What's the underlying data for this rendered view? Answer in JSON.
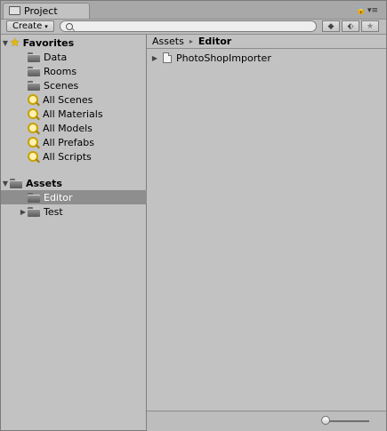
{
  "window": {
    "tab_title": "Project"
  },
  "toolbar": {
    "create_label": "Create",
    "create_caret": "▾",
    "search_placeholder": "",
    "search_value": ""
  },
  "favorites": {
    "label": "Favorites",
    "items": [
      {
        "label": "Data",
        "icon": "folder-icon"
      },
      {
        "label": "Rooms",
        "icon": "folder-icon"
      },
      {
        "label": "Scenes",
        "icon": "folder-icon"
      },
      {
        "label": "All Scenes",
        "icon": "search-icon"
      },
      {
        "label": "All Materials",
        "icon": "search-icon"
      },
      {
        "label": "All Models",
        "icon": "search-icon"
      },
      {
        "label": "All Prefabs",
        "icon": "search-icon"
      },
      {
        "label": "All Scripts",
        "icon": "search-icon"
      }
    ]
  },
  "assets": {
    "label": "Assets",
    "children": [
      {
        "label": "Editor",
        "selected": true,
        "expandable": false
      },
      {
        "label": "Test",
        "selected": false,
        "expandable": true
      }
    ]
  },
  "breadcrumb": {
    "root": "Assets",
    "separator": "▸",
    "current": "Editor"
  },
  "content": {
    "items": [
      {
        "label": "PhotoShopImporter",
        "type": "file"
      }
    ]
  },
  "colors": {
    "background": "#c2c2c2",
    "selection": "#8e8e8e",
    "favorite_star": "#e6b800"
  }
}
